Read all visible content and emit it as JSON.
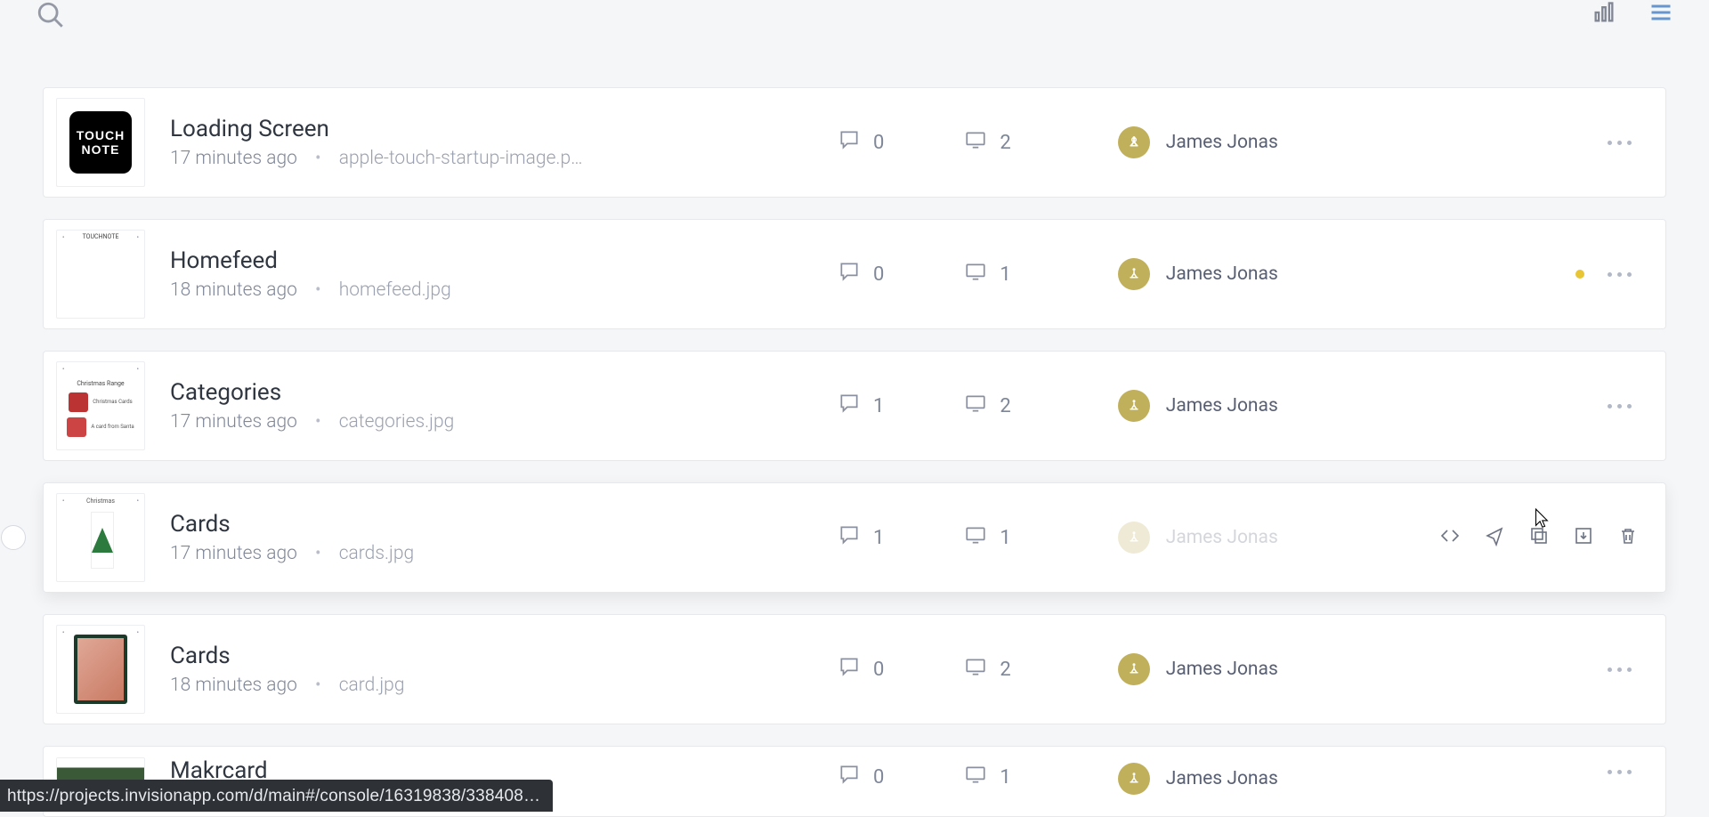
{
  "statusBarUrl": "https://projects.invisionapp.com/d/main#/console/16319838/338408…",
  "author": "James Jonas",
  "thumbLabels": {
    "touchnote_l1": "TOUCH",
    "touchnote_l2": "NOTE",
    "homefeed_bar": "TOUCHNOTE",
    "categories_hdr": "Christmas Range",
    "categories_i1": "Christmas Cards",
    "categories_i2": "A card from Santa",
    "cards_hdr": "Christmas"
  },
  "rows": [
    {
      "title": "Loading Screen",
      "time": "17 minutes ago",
      "filename": "apple-touch-startup-image.p…",
      "comments": "0",
      "screens": "2",
      "hasDot": false,
      "hovered": false
    },
    {
      "title": "Homefeed",
      "time": "18 minutes ago",
      "filename": "homefeed.jpg",
      "comments": "0",
      "screens": "1",
      "hasDot": true,
      "hovered": false
    },
    {
      "title": "Categories",
      "time": "17 minutes ago",
      "filename": "categories.jpg",
      "comments": "1",
      "screens": "2",
      "hasDot": false,
      "hovered": false
    },
    {
      "title": "Cards",
      "time": "17 minutes ago",
      "filename": "cards.jpg",
      "comments": "1",
      "screens": "1",
      "hasDot": false,
      "hovered": true
    },
    {
      "title": "Cards",
      "time": "18 minutes ago",
      "filename": "card.jpg",
      "comments": "0",
      "screens": "2",
      "hasDot": false,
      "hovered": false
    },
    {
      "title": "Makrcard",
      "time": "",
      "filename": "",
      "comments": "0",
      "screens": "1",
      "hasDot": false,
      "hovered": false
    }
  ]
}
